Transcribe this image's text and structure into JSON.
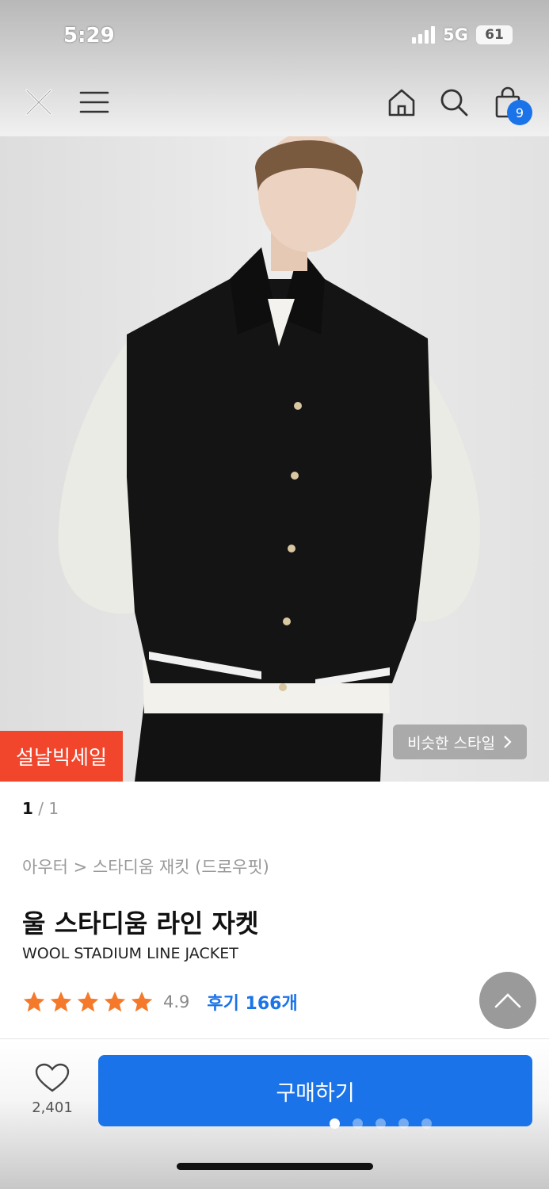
{
  "status": {
    "time": "5:29",
    "network": "5G",
    "battery": "61"
  },
  "nav": {
    "cart_count": "9"
  },
  "product": {
    "sale_tag": "설날빅세일",
    "similar_style_label": "비슷한 스타일",
    "pager_current": "1",
    "pager_total": "/ 1",
    "breadcrumb": "아우터 > 스타디움 재킷 (드로우핏)",
    "name_ko": "울 스타디움 라인 자켓",
    "name_en": "WOOL STADIUM LINE JACKET",
    "rating": "4.9",
    "rating_stars": 5,
    "review_label": "후기 166개"
  },
  "bottom": {
    "like_count": "2,401",
    "buy_label": "구매하기"
  },
  "colors": {
    "accent": "#1a73e8",
    "sale": "#f2462c",
    "star": "#f4792a"
  },
  "icons": [
    "close-icon",
    "menu-icon",
    "home-icon",
    "search-icon",
    "shopping-bag-icon",
    "star-icon",
    "chevron-up-icon",
    "heart-icon",
    "chevron-right-icon"
  ]
}
